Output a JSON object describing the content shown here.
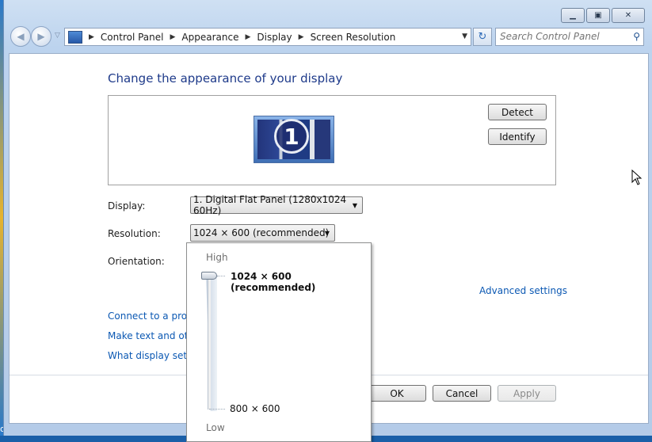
{
  "window": {
    "caption_icons": [
      "minimize-icon",
      "maximize-icon",
      "close-icon"
    ]
  },
  "address": {
    "breadcrumbs": [
      "Control Panel",
      "Appearance",
      "Display",
      "Screen Resolution"
    ]
  },
  "search": {
    "placeholder": "Search Control Panel"
  },
  "main": {
    "title": "Change the appearance of your display",
    "monitor_number": "1",
    "detect_label": "Detect",
    "identify_label": "Identify",
    "display_label": "Display:",
    "display_value": "1. Digital Flat Panel (1280x1024 60Hz)",
    "resolution_label": "Resolution:",
    "resolution_value": "1024 × 600 (recommended)",
    "orientation_label": "Orientation:",
    "advanced_link": "Advanced settings",
    "links": [
      "Connect to a projec",
      "Make text and other",
      "What display setting"
    ]
  },
  "resolution_popup": {
    "high_label": "High",
    "low_label": "Low",
    "current_value": "1024 × 600 (recommended)",
    "min_value": "800 × 600",
    "slider_level": 1.0
  },
  "footer": {
    "ok_label": "OK",
    "cancel_label": "Cancel",
    "apply_label": "Apply"
  },
  "desktop": {
    "edge_text": "or"
  },
  "colors": {
    "title": "#1e3a8a",
    "link": "#0b58b3",
    "window_frame": "#bcd3ee"
  }
}
